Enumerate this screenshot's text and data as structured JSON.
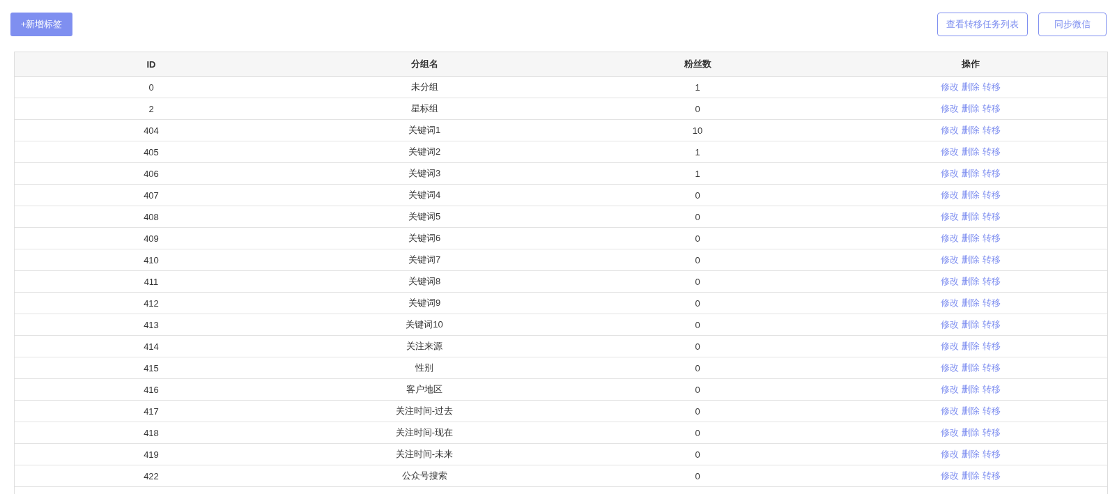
{
  "toolbar": {
    "add_button": "+新增标签",
    "right_buttons": [
      "查看转移任务列表",
      "同步微信"
    ]
  },
  "table": {
    "columns": [
      "ID",
      "分组名",
      "粉丝数",
      "操作"
    ],
    "rows": [
      {
        "id": "0",
        "name": "未分组",
        "fans": "1",
        "actions": [
          "修改",
          "删除",
          "转移"
        ]
      },
      {
        "id": "2",
        "name": "星标组",
        "fans": "0",
        "actions": [
          "修改",
          "删除",
          "转移"
        ]
      },
      {
        "id": "404",
        "name": "关键词1",
        "fans": "10",
        "actions": [
          "修改",
          "删除",
          "转移"
        ]
      },
      {
        "id": "405",
        "name": "关键词2",
        "fans": "1",
        "actions": [
          "修改",
          "删除",
          "转移"
        ]
      },
      {
        "id": "406",
        "name": "关键词3",
        "fans": "1",
        "actions": [
          "修改",
          "删除",
          "转移"
        ]
      },
      {
        "id": "407",
        "name": "关键词4",
        "fans": "0",
        "actions": [
          "修改",
          "删除",
          "转移"
        ]
      },
      {
        "id": "408",
        "name": "关键词5",
        "fans": "0",
        "actions": [
          "修改",
          "删除",
          "转移"
        ]
      },
      {
        "id": "409",
        "name": "关键词6",
        "fans": "0",
        "actions": [
          "修改",
          "删除",
          "转移"
        ]
      },
      {
        "id": "410",
        "name": "关键词7",
        "fans": "0",
        "actions": [
          "修改",
          "删除",
          "转移"
        ]
      },
      {
        "id": "411",
        "name": "关键词8",
        "fans": "0",
        "actions": [
          "修改",
          "删除",
          "转移"
        ]
      },
      {
        "id": "412",
        "name": "关键词9",
        "fans": "0",
        "actions": [
          "修改",
          "删除",
          "转移"
        ]
      },
      {
        "id": "413",
        "name": "关键词10",
        "fans": "0",
        "actions": [
          "修改",
          "删除",
          "转移"
        ]
      },
      {
        "id": "414",
        "name": "关注来源",
        "fans": "0",
        "actions": [
          "修改",
          "删除",
          "转移"
        ]
      },
      {
        "id": "415",
        "name": "性别",
        "fans": "0",
        "actions": [
          "修改",
          "删除",
          "转移"
        ]
      },
      {
        "id": "416",
        "name": "客户地区",
        "fans": "0",
        "actions": [
          "修改",
          "删除",
          "转移"
        ]
      },
      {
        "id": "417",
        "name": "关注时间-过去",
        "fans": "0",
        "actions": [
          "修改",
          "删除",
          "转移"
        ]
      },
      {
        "id": "418",
        "name": "关注时间-现在",
        "fans": "0",
        "actions": [
          "修改",
          "删除",
          "转移"
        ]
      },
      {
        "id": "419",
        "name": "关注时间-未来",
        "fans": "0",
        "actions": [
          "修改",
          "删除",
          "转移"
        ]
      },
      {
        "id": "422",
        "name": "公众号搜索",
        "fans": "0",
        "actions": [
          "修改",
          "删除",
          "转移"
        ]
      }
    ]
  }
}
